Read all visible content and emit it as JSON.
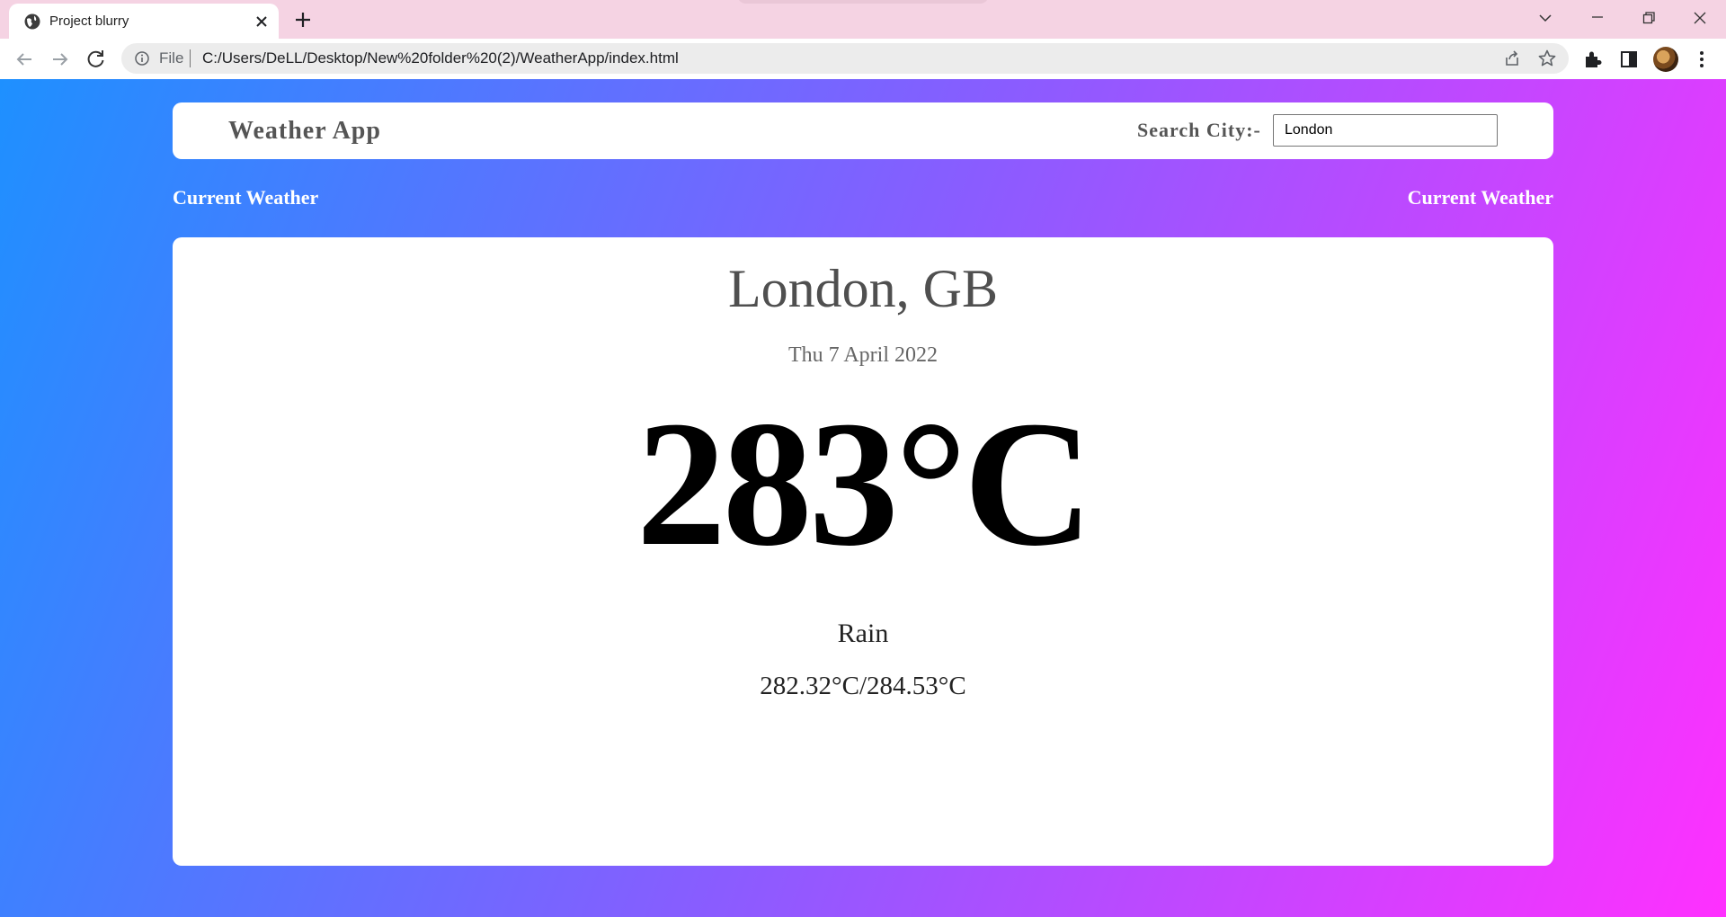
{
  "browser": {
    "tab_title": "Project blurry",
    "omnibox_scheme": "File",
    "url": "C:/Users/DeLL/Desktop/New%20folder%20(2)/WeatherApp/index.html"
  },
  "app": {
    "brand": "Weather App",
    "search_label": "Search City:-",
    "search_value": "London",
    "section_left": "Current Weather",
    "section_right": "Current Weather"
  },
  "weather": {
    "location": "London, GB",
    "date": "Thu 7 April 2022",
    "temperature": "283°C",
    "condition": "Rain",
    "min_max": "282.32°C/284.53°C"
  },
  "colors": {
    "gradient_start": "#1e90ff",
    "gradient_mid": "#8a5cff",
    "gradient_end": "#ff30ff",
    "tabstrip": "#f5d3e3"
  }
}
